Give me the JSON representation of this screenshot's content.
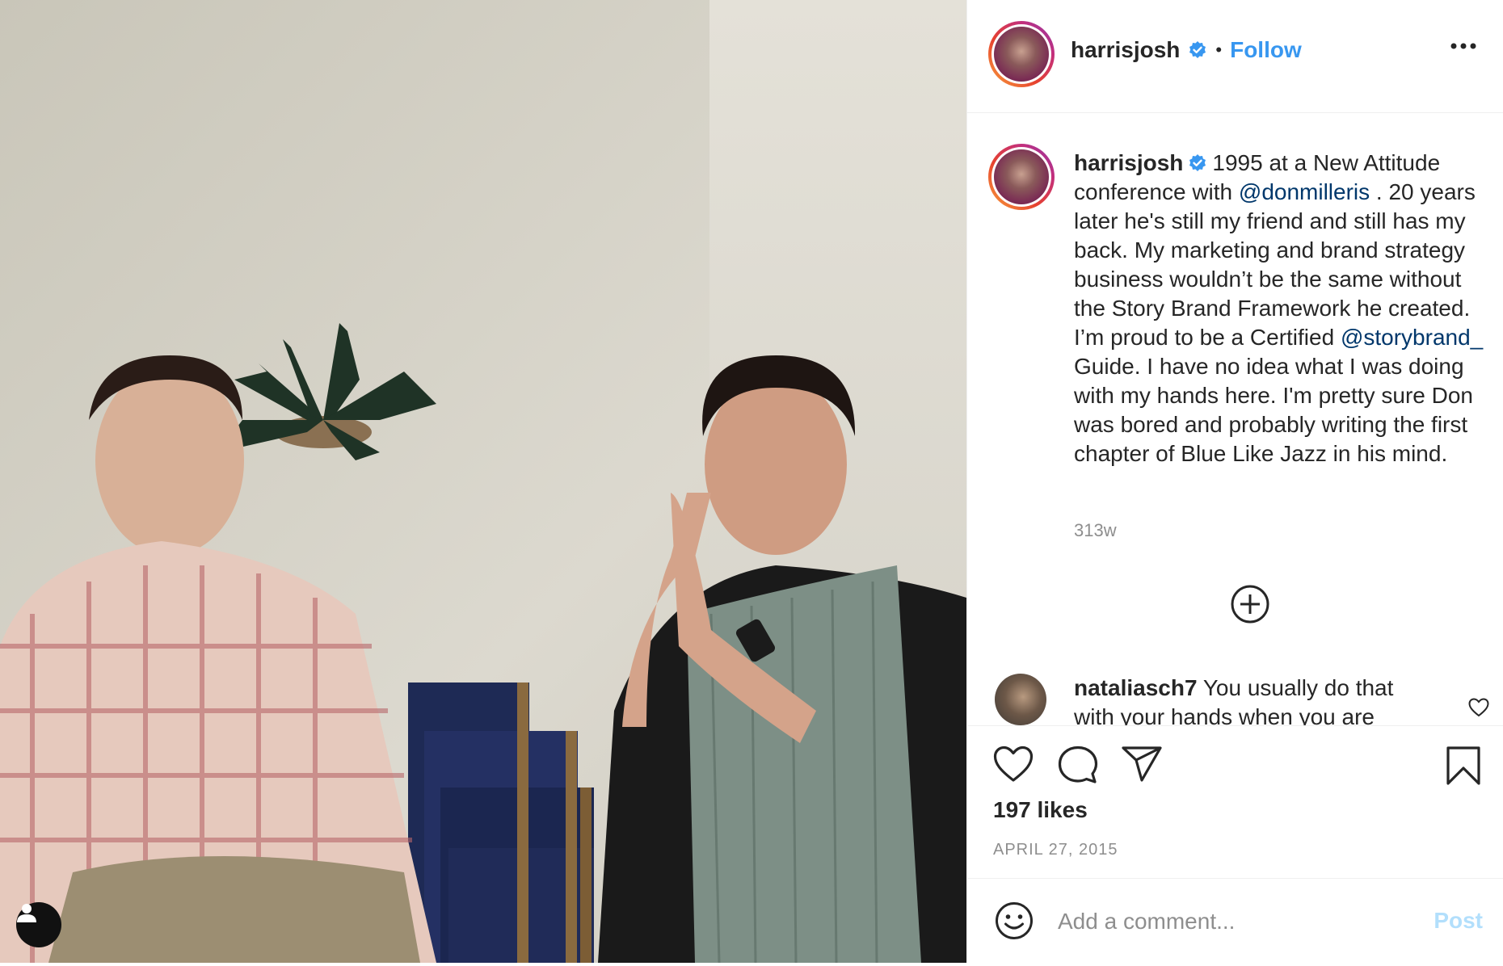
{
  "post": {
    "username": "harrisjosh",
    "follow_label": "Follow",
    "separator": "•",
    "caption_text_1": "1995 at a New Attitude conference with",
    "mention_1": "@donmilleris",
    "caption_text_2": ". 20 years later he's still my friend and still has my back. My marketing and brand strategy business wouldn’t be the same without the Story Brand Framework he created. I’m proud to be a Certified",
    "mention_2": "@storybrand_",
    "caption_text_3": "Guide. I have no idea what I was doing with my hands here. I'm pretty sure Don was bored and probably writing the first chapter of Blue Like Jazz in his mind.",
    "time_ago": "313w",
    "likes": "197 likes",
    "date": "APRIL 27, 2015"
  },
  "comment": {
    "username": "nataliasch7",
    "text": "You usually do that with your hands when you are"
  },
  "add_comment": {
    "placeholder": "Add a comment...",
    "post_label": "Post"
  },
  "icons": {
    "verified": "verified-badge-icon",
    "more": "more-options-icon",
    "plus": "load-more-comments-icon",
    "like": "heart-icon",
    "comment": "comment-bubble-icon",
    "share": "paper-plane-icon",
    "save": "bookmark-icon",
    "emoji": "emoji-icon",
    "user_tag": "user-tag-icon"
  },
  "colors": {
    "accent": "#3897f0",
    "mention": "#00376b",
    "muted": "#8e8e8e",
    "post_disabled": "#b2dffc"
  }
}
